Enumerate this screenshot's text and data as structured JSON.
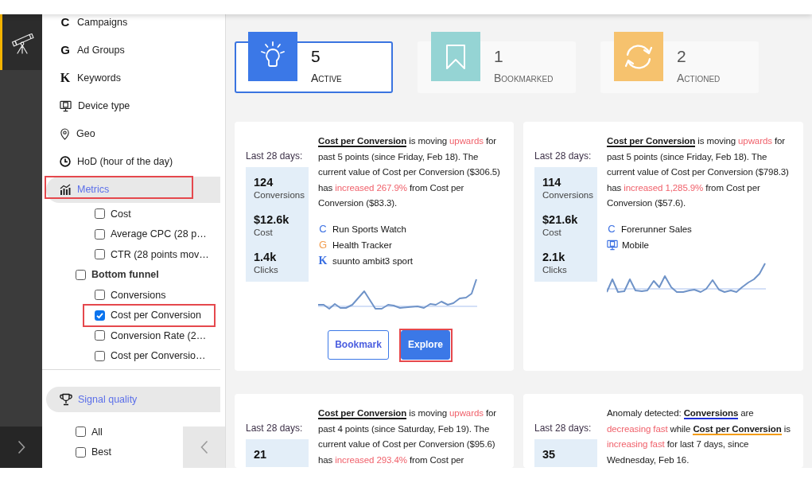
{
  "rail": {
    "items": [
      {
        "kind": "telescope",
        "selected": true
      }
    ]
  },
  "sidebar": {
    "items": [
      {
        "kind": "campaign",
        "icon": "C",
        "label": "Campaigns",
        "expanded": false,
        "highlighted": false
      },
      {
        "kind": "ad_group",
        "icon": "G",
        "label": "Ad Groups",
        "expanded": false,
        "highlighted": false
      },
      {
        "kind": "keyword",
        "icon": "K",
        "label": "Keywords",
        "expanded": false,
        "highlighted": false
      },
      {
        "kind": "device",
        "label": "Device type",
        "expanded": false,
        "highlighted": false
      },
      {
        "kind": "geo",
        "label": "Geo",
        "expanded": false,
        "highlighted": false
      },
      {
        "kind": "hod",
        "label": "HoD (hour of the day)",
        "expanded": false,
        "highlighted": false
      },
      {
        "kind": "metrics",
        "label": "Metrics",
        "expanded": true,
        "highlighted": true,
        "children": [
          {
            "children": [
              {
                "label": "Cost",
                "checked": false,
                "highlighted": false
              },
              {
                "label": "Average CPC (28 p…",
                "checked": false,
                "highlighted": false
              },
              {
                "label": "CTR (28 points mov…",
                "checked": false,
                "highlighted": false
              }
            ]
          },
          {
            "label": "Bottom funnel",
            "checked": false,
            "children": [
              {
                "label": "Conversions",
                "checked": false,
                "highlighted": false
              },
              {
                "label": "Cost per Conversion",
                "checked": true,
                "highlighted": true
              },
              {
                "label": "Conversion Rate (2…",
                "checked": false,
                "highlighted": false
              },
              {
                "label": "Cost per Conversio…",
                "checked": false,
                "highlighted": false
              }
            ]
          }
        ]
      }
    ],
    "signal_quality": {
      "label": "Signal quality",
      "expanded": true,
      "options": [
        {
          "label": "All",
          "checked": false
        },
        {
          "label": "Best",
          "checked": false
        }
      ]
    }
  },
  "status_tiles": [
    {
      "kind": "active",
      "count": "5",
      "label": "Active",
      "selected": true
    },
    {
      "kind": "bookmarked",
      "count": "1",
      "label": "Bookmarked",
      "selected": false
    },
    {
      "kind": "actioned",
      "count": "2",
      "label": "Actioned",
      "selected": false
    }
  ],
  "insights": [
    {
      "period_label": "Last 28 days:",
      "stats": [
        {
          "value": "124",
          "label": "Conversions"
        },
        {
          "value": "$12.6k",
          "label": "Cost"
        },
        {
          "value": "1.4k",
          "label": "Clicks"
        }
      ],
      "text": [
        {
          "kind": "metric",
          "text": "Cost per Conversion"
        },
        {
          "kind": "plain",
          "text": " is moving "
        },
        {
          "kind": "alert",
          "text": "upwards"
        },
        {
          "kind": "plain",
          "text": " for past 5 points (since Friday, Feb 18). The current value of Cost per Conversion ($306.5) has "
        },
        {
          "kind": "alert",
          "text": "increased 267.9%"
        },
        {
          "kind": "plain",
          "text": " from Cost per Conversion ($83.3)."
        }
      ],
      "entities": [
        {
          "kind": "campaign",
          "icon": "C",
          "label": "Run Sports Watch"
        },
        {
          "kind": "ad_group",
          "icon": "G",
          "label": "Health Tracker"
        },
        {
          "kind": "keyword",
          "icon": "K",
          "label": "suunto ambit3 sport"
        }
      ],
      "buttons": [
        {
          "kind": "secondary",
          "label": "Bookmark",
          "highlighted": false
        },
        {
          "kind": "primary",
          "label": "Explore",
          "highlighted": true
        }
      ]
    },
    {
      "period_label": "Last 28 days:",
      "stats": [
        {
          "value": "114",
          "label": "Conversions"
        },
        {
          "value": "$21.6k",
          "label": "Cost"
        },
        {
          "value": "2.1k",
          "label": "Clicks"
        }
      ],
      "text": [
        {
          "kind": "metric",
          "text": "Cost per Conversion"
        },
        {
          "kind": "plain",
          "text": " is moving "
        },
        {
          "kind": "alert",
          "text": "upwards"
        },
        {
          "kind": "plain",
          "text": " for past 5 points (since Friday, Feb 18). The current value of Cost per Conversion ($798.3) has "
        },
        {
          "kind": "alert",
          "text": "increased 1,285.9%"
        },
        {
          "kind": "plain",
          "text": " from Cost per Conversion ($57.6)."
        }
      ],
      "entities": [
        {
          "kind": "campaign",
          "icon": "C",
          "label": "Forerunner Sales"
        },
        {
          "kind": "device",
          "label": "Mobile"
        }
      ]
    },
    {
      "period_label": "Last 28 days:",
      "stats": [
        {
          "value": "21"
        }
      ],
      "text": [
        {
          "kind": "metric",
          "text": "Cost per Conversion"
        },
        {
          "kind": "plain",
          "text": " is moving "
        },
        {
          "kind": "alert",
          "text": "upwards"
        },
        {
          "kind": "plain",
          "text": " for past 4 points (since Saturday, Feb 19). The current value of Cost per Conversion ($95.6) has "
        },
        {
          "kind": "alert",
          "text": "increased 293.4%"
        },
        {
          "kind": "plain",
          "text": " from Cost per"
        }
      ]
    },
    {
      "period_label": "Last 28 days:",
      "stats": [
        {
          "value": "35"
        }
      ],
      "text": [
        {
          "kind": "plain",
          "text": "Anomaly detected: "
        },
        {
          "kind": "metric",
          "text": "Conversions",
          "color": "#1f2fd6"
        },
        {
          "kind": "plain",
          "text": " are "
        },
        {
          "kind": "alert",
          "text": "decreasing fast"
        },
        {
          "kind": "plain",
          "text": " while "
        },
        {
          "kind": "metric",
          "text": "Cost per Conversion",
          "color": "#f39c12"
        },
        {
          "kind": "plain",
          "text": " is "
        },
        {
          "kind": "alert",
          "text": "increasing fast"
        },
        {
          "kind": "plain",
          "text": " for last 7 days, since Wednesday, Feb 16."
        }
      ]
    }
  ]
}
